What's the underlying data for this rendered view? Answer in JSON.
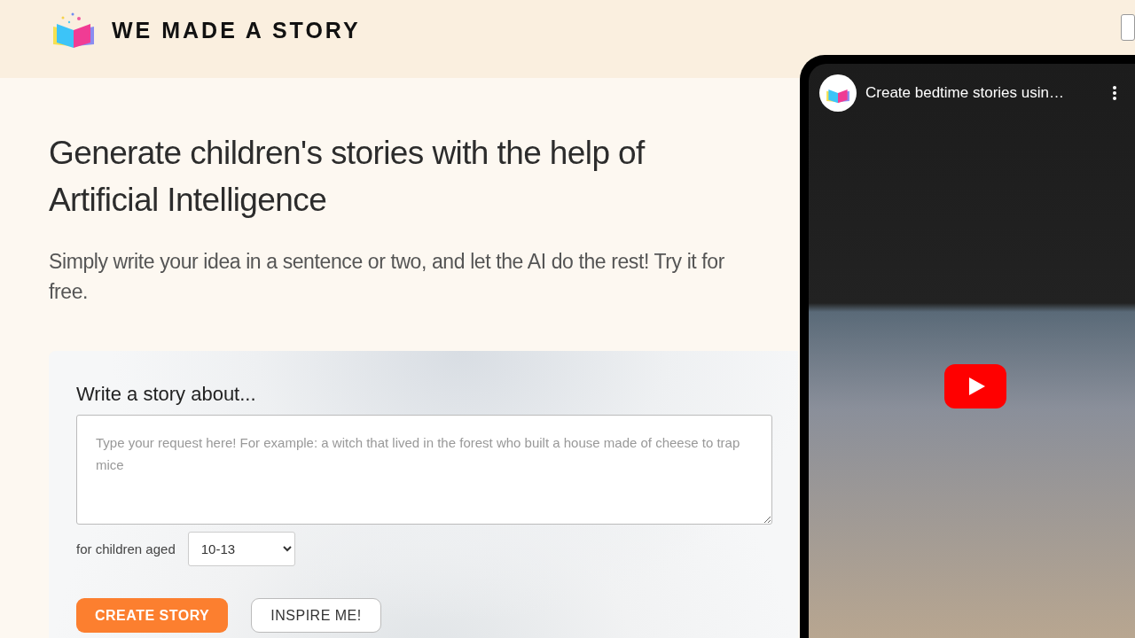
{
  "header": {
    "brand": "WE MADE A STORY"
  },
  "hero": {
    "title": "Generate children's stories with the help of Artificial Intelligence",
    "subtitle": "Simply write your idea in a sentence or two, and let the AI do the rest! Try it for free."
  },
  "form": {
    "heading": "Write a story about...",
    "request_field": {
      "placeholder": "Type your request here! For example: a witch that lived in the forest who built a house made of cheese to trap mice"
    },
    "age_label": "for children aged",
    "age_select": {
      "value": "10-13"
    },
    "buttons": [
      {
        "label": "CREATE STORY",
        "kind": "primary"
      },
      {
        "label": "INSPIRE ME!",
        "kind": "secondary"
      }
    ]
  },
  "video": {
    "title": "Create bedtime stories usin…"
  }
}
